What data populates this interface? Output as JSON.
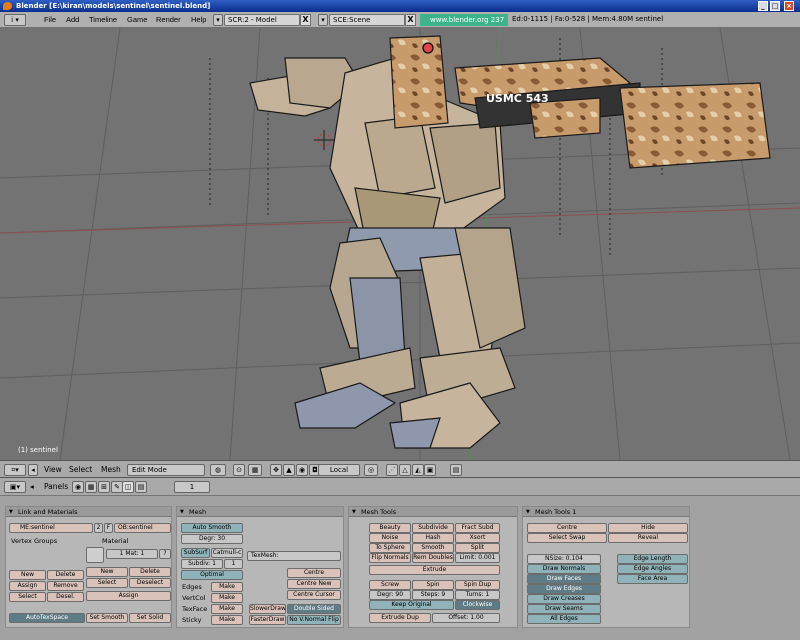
{
  "window": {
    "title": "Blender [E:\\kiran\\models\\sentinel\\sentinel.blend]",
    "min": "_",
    "max": "□",
    "close": "×"
  },
  "menubar": {
    "items": [
      "File",
      "Add",
      "Timeline",
      "Game",
      "Render",
      "Help"
    ],
    "screen_field": "SCR:2 - Model",
    "scene_field": "SCE:Scene",
    "close_glyph": "X",
    "url": "www.blender.org 237",
    "stats": "Ed:0-1115 | Fa:0-528 | Mem:4.80M  sentinel"
  },
  "viewport": {
    "object_label": "(1) sentinel",
    "decal_text": "USMC  543"
  },
  "view_header": {
    "menus": [
      "View",
      "Select",
      "Mesh"
    ],
    "mode": "Edit Mode",
    "orientation": "Local"
  },
  "buttons_header": {
    "label": "Panels",
    "frame": "1"
  },
  "panels": {
    "link_materials": {
      "title": "Link and Materials",
      "me_field": "ME:sentinel",
      "users": "2",
      "fake": "F",
      "ob_field": "OB:sentinel",
      "vertex_groups": "Vertex Groups",
      "material": "Material",
      "mat_index": "1 Mat: 1",
      "question": "?",
      "vg_buttons": [
        "New",
        "Delete",
        "Assign",
        "Remove",
        "Select",
        "Desel."
      ],
      "mat_buttons": [
        "New",
        "Delete",
        "Select",
        "Deselect",
        "Assign"
      ],
      "autotexspace": "AutoTexSpace",
      "set_smooth": "Set Smooth",
      "set_solid": "Set Solid"
    },
    "mesh": {
      "title": "Mesh",
      "auto_smooth": "Auto Smooth",
      "degr": "Degr: 30",
      "subsurf": "SubSurf",
      "catmull": "Catmull-c",
      "subdiv": "Subdiv: 1",
      "subdiv_r": "1",
      "optimal": "Optimal",
      "texmesh": "TexMesh:",
      "rows": [
        "Edges",
        "VertCol",
        "TexFace",
        "Sticky"
      ],
      "make": "Make",
      "centre": "Centre",
      "centre_new": "Centre New",
      "centre_cursor": "Centre Cursor",
      "slower_draw": "SlowerDraw",
      "faster_draw": "FasterDraw",
      "double_sided": "Double Sided",
      "no_vnormal": "No V.Normal Flip"
    },
    "mesh_tools": {
      "title": "Mesh Tools",
      "grid": [
        [
          "Beauty",
          "Subdivide",
          "Fract Subd"
        ],
        [
          "Noise",
          "Hash",
          "Xsort"
        ],
        [
          "To Sphere",
          "Smooth",
          "Split"
        ],
        [
          "Flip Normals",
          "Rem Doubles",
          "Limit: 0.001"
        ]
      ],
      "extrude": "Extrude",
      "screw": "Screw",
      "spin": "Spin",
      "spin_dup": "Spin Dup",
      "degr": "Degr: 90",
      "steps": "Steps: 9",
      "turns": "Turns: 1",
      "keep_original": "Keep Original",
      "clockwise": "Clockwise",
      "extrude_dup": "Extrude Dup",
      "offset": "Offset: 1.00"
    },
    "mesh_tools_1": {
      "title": "Mesh Tools 1",
      "centre": "Centre",
      "hide": "Hide",
      "select_swap": "Select Swap",
      "reveal": "Reveal",
      "nsize": "NSize: 0.104",
      "draw_left": [
        "Draw Normals",
        "Draw Faces",
        "Draw Edges",
        "Draw Creases",
        "Draw Seams",
        "All Edges"
      ],
      "draw_right": [
        "Edge Length",
        "Edge Angles",
        "Face Area"
      ]
    }
  }
}
